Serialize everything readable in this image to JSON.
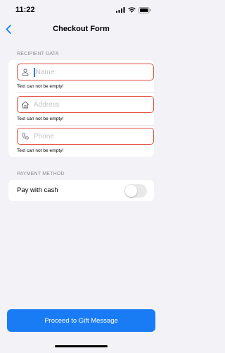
{
  "status_bar": {
    "time": "11:22",
    "icons": [
      "signal-icon",
      "wifi-icon",
      "battery-icon"
    ]
  },
  "nav": {
    "title": "Checkout Form",
    "back_icon": "chevron-left-icon"
  },
  "recipient": {
    "header": "RECIPIENT DATA",
    "fields": [
      {
        "placeholder": "Name",
        "value": "",
        "icon": "person-icon",
        "error": "Text can not be empty!",
        "focused": true
      },
      {
        "placeholder": "Address",
        "value": "",
        "icon": "house-icon",
        "error": "Text can not be empty!",
        "focused": false
      },
      {
        "placeholder": "Phone",
        "value": "",
        "icon": "phone-icon",
        "error": "Text can not be empty!",
        "focused": false
      }
    ]
  },
  "payment": {
    "header": "PAYMENT METHOD",
    "cash_label": "Pay with cash",
    "cash_enabled": false
  },
  "actions": {
    "proceed_label": "Proceed to Gift Message"
  },
  "colors": {
    "accent": "#1a7cf5",
    "error_border": "#e0503c",
    "background": "#f2f2f7"
  }
}
